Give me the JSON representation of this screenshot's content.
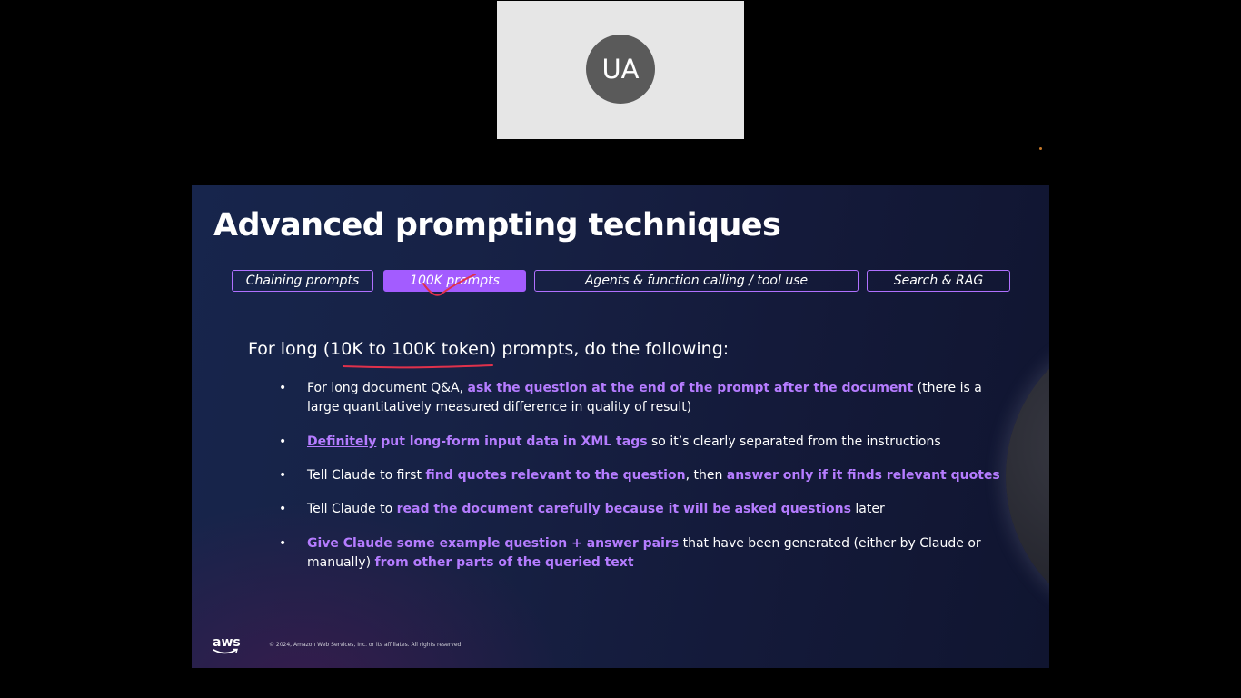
{
  "participant": {
    "initials": "UA"
  },
  "slide": {
    "title": "Advanced prompting techniques",
    "tabs": [
      {
        "label": "Chaining prompts",
        "active": false
      },
      {
        "label": "100K prompts",
        "active": true
      },
      {
        "label": "Agents & function calling / tool use",
        "active": false
      },
      {
        "label": "Search & RAG",
        "active": false
      }
    ],
    "lead": "For long (10K to 100K token) prompts, do the following:",
    "bullet_symbol": "•",
    "bullets": [
      {
        "t1": "For long document Q&A, ",
        "h1": "ask the question at the end of the prompt after the document",
        "t2": " (there is a large quantitatively measured difference in quality of result)"
      },
      {
        "h1": "Definitely",
        "h2": " put long-form input data in XML tags",
        "t1": " so it’s clearly separated from the instructions"
      },
      {
        "t1": "Tell Claude to first ",
        "h1": "find quotes relevant to the question",
        "t2": ", then ",
        "h2": "answer only if it finds relevant quotes"
      },
      {
        "t1": "Tell Claude to ",
        "h1": "read the document carefully because it will be asked questions",
        "t2": " later"
      },
      {
        "h1": "Give Claude some example question + answer pairs",
        "t1": " that have been generated (either by Claude or manually) ",
        "h2": "from other parts of the queried text"
      }
    ],
    "footer": {
      "logo_text": "aws",
      "copyright": "© 2024, Amazon Web Services, Inc. or its affiliates. All rights reserved."
    }
  },
  "colors": {
    "accent": "#a35cff",
    "highlight_text": "#b57cff",
    "annotation_ink": "#e0314b",
    "aws_smile": "#ff9900",
    "background": "#000000",
    "tile": "#e6e6e6"
  }
}
